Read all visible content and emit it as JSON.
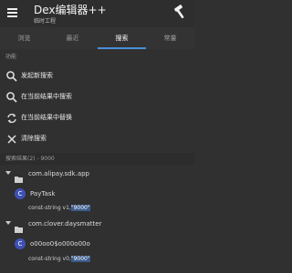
{
  "app": {
    "title": "Dex编辑器++",
    "subtitle": "临时工程"
  },
  "tabs": [
    {
      "label": "浏览"
    },
    {
      "label": "最近"
    },
    {
      "label": "搜索"
    },
    {
      "label": "常量"
    }
  ],
  "functions": {
    "header": "功能",
    "items": [
      {
        "label": "发起新搜索",
        "icon": "search-icon"
      },
      {
        "label": "在当前结果中搜索",
        "icon": "search-icon"
      },
      {
        "label": "在当前结果中替换",
        "icon": "replace-icon"
      },
      {
        "label": "清除搜索",
        "icon": "close-icon"
      }
    ]
  },
  "results": {
    "header": "搜索结果(2) - 9000",
    "groups": [
      {
        "package": "com.alipay.sdk.app",
        "class": "PayTask",
        "code_prefix": "const-string v1,",
        "code_match": "\"9000\""
      },
      {
        "package": "com.clover.daysmatter",
        "class": "o00oo0$o000o00o",
        "code_prefix": "const-string v0,",
        "code_match": "\"9000\""
      }
    ]
  },
  "colors": {
    "background": "#303030",
    "tab_indicator": "#4a90d9",
    "class_icon": "#3f51b5",
    "match_highlight": "#3b5b8a"
  }
}
